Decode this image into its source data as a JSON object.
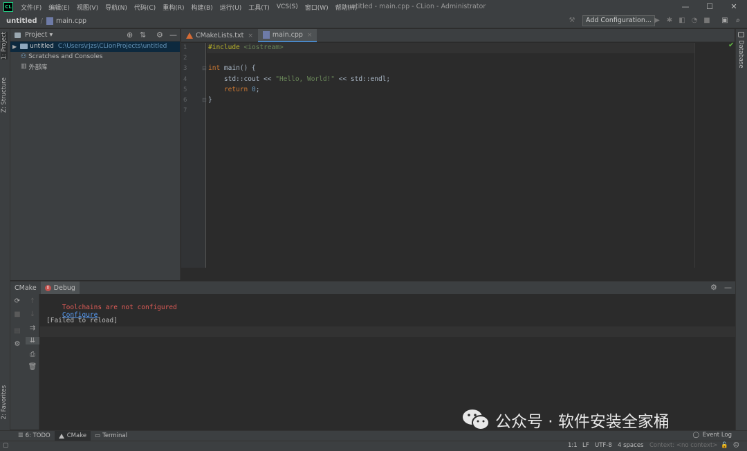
{
  "window": {
    "logo": "CL",
    "menu": [
      "文件(F)",
      "编辑(E)",
      "视图(V)",
      "导航(N)",
      "代码(C)",
      "重构(R)",
      "构建(B)",
      "运行(U)",
      "工具(T)",
      "VCS(S)",
      "窗口(W)",
      "帮助(H)"
    ],
    "title": "untitled - main.cpp - CLion - Administrator",
    "minimize": "—",
    "maximize": "☐",
    "close": "✕"
  },
  "navbar": {
    "project": "untitled",
    "file": "main.cpp",
    "add_configuration": "Add Configuration..."
  },
  "left_strip": {
    "project_tab": "1: Project",
    "structure_tab": "Z: Structure",
    "favorites_tab": "2: Favorites"
  },
  "right_strip": {
    "database_tab": "Database"
  },
  "project_panel": {
    "title": "Project ▾",
    "tree": [
      {
        "label": "untitled",
        "path": "C:\\Users\\rjzs\\CLionProjects\\untitled"
      },
      {
        "label": "Scratches and Consoles"
      },
      {
        "label": "外部库"
      }
    ]
  },
  "editor": {
    "tabs": [
      {
        "label": "CMakeLists.txt",
        "close": "×"
      },
      {
        "label": "main.cpp",
        "close": "×"
      }
    ],
    "line_numbers": [
      "1",
      "2",
      "3",
      "4",
      "5",
      "6",
      "7"
    ]
  },
  "tool_window": {
    "tabs": [
      "CMake",
      "Debug"
    ],
    "error_icon": "!",
    "console": {
      "error_text": "Toolchains are not configured",
      "configure_link": "Configure",
      "failed": "[Failed to reload]"
    }
  },
  "bottom_tabs": {
    "todo": "6: TODO",
    "cmake": "CMake",
    "terminal": "Terminal",
    "event_log": "Event Log"
  },
  "statusbar": {
    "position": "1:1",
    "line_sep": "LF",
    "encoding": "UTF-8",
    "indent": "4 spaces",
    "context": "Context: <no context>"
  },
  "watermark": {
    "text": "公众号 · 软件安装全家桶"
  }
}
